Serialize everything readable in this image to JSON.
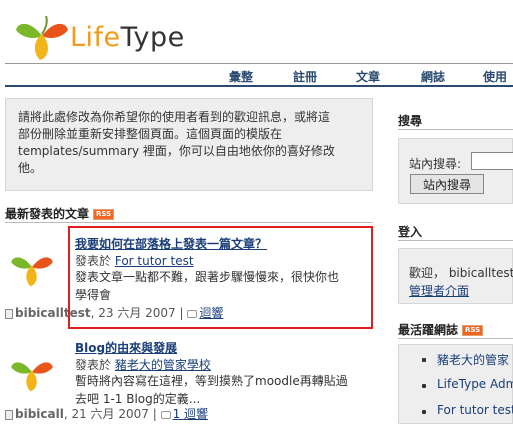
{
  "header": {
    "logo_text_a": "Life",
    "logo_text_b": "Type"
  },
  "nav": [
    "彙整",
    "註冊",
    "文章",
    "網誌",
    "使用"
  ],
  "welcome": {
    "lines": [
      "請將此處修改為你希望你的使用者看到的歡迎訊息，或將這",
      "部份刪除並重新安排整個頁面。這個頁面的模版在",
      "templates/summary 裡面，你可以自由地依你的喜好修改",
      "他。"
    ]
  },
  "recent": {
    "title": "最新發表的文章",
    "rss": "RSS",
    "posts": [
      {
        "title": "我要如何在部落格上發表一篇文章？",
        "posted_in": "發表於",
        "category": "For tutor test",
        "body": [
          "發表文章一點都不難，跟著步驟慢慢來，很快你也",
          "學得會"
        ],
        "author": "bibicalltest",
        "date": ", 23 六月 2007 |",
        "comments": "迴響"
      },
      {
        "title": "Blog的由來與發展",
        "posted_in": "發表於",
        "category": "豬老大的管家學校",
        "body": [
          "暫時將內容寫在這裡，等到摸熟了moodle再轉貼過",
          "去吧 1-1 Blog的定義..."
        ],
        "author": "bibicall",
        "date": ", 21 六月 2007 |",
        "comments": "1 迴響"
      }
    ]
  },
  "sidebar": {
    "search_title": "搜尋",
    "search_label": "站內搜尋:",
    "search_button": "站內搜尋",
    "login_title": "登入",
    "welcome_text": "歡迎， bibicalltest",
    "admin_link": "管理者介面",
    "active_title": "最活躍網誌",
    "rss": "RSS",
    "active_blogs": [
      "豬老大的管家",
      "LifeType Adm",
      "For tutor test"
    ]
  },
  "colors": {
    "accent": "#1a3e7a",
    "highlight": "#e02020",
    "rss": "#f26522"
  }
}
